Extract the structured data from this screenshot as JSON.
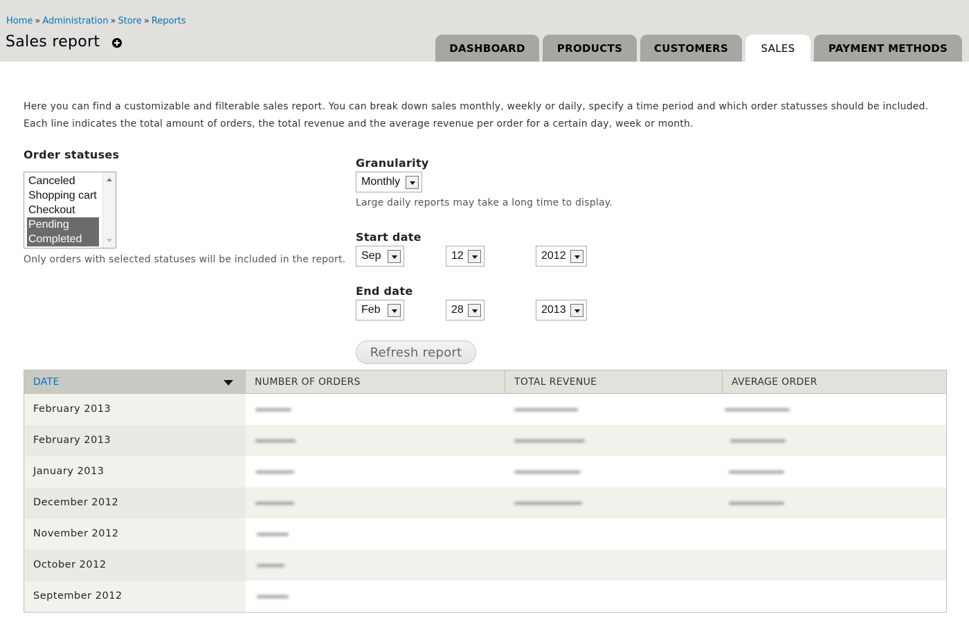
{
  "breadcrumb": {
    "items": [
      "Home",
      "Administration",
      "Store",
      "Reports"
    ],
    "separator": "»"
  },
  "page": {
    "title": "Sales report"
  },
  "tabs": [
    {
      "label": "DASHBOARD",
      "active": false
    },
    {
      "label": "PRODUCTS",
      "active": false
    },
    {
      "label": "CUSTOMERS",
      "active": false
    },
    {
      "label": "SALES",
      "active": true
    },
    {
      "label": "PAYMENT METHODS",
      "active": false
    }
  ],
  "intro": {
    "line1": "Here you can find a customizable and filterable sales report. You can break down sales monthly, weekly or daily, specify a time period and which order statusses should be included.",
    "line2": "Each line indicates the total amount of orders, the total revenue and the average revenue per order for a certain day, week or month."
  },
  "order_statuses": {
    "label": "Order statuses",
    "options": [
      {
        "label": "Canceled",
        "selected": false
      },
      {
        "label": "Shopping cart",
        "selected": false
      },
      {
        "label": "Checkout",
        "selected": false
      },
      {
        "label": "Pending",
        "selected": true
      },
      {
        "label": "Completed",
        "selected": true
      }
    ],
    "description": "Only orders with selected statuses will be included in the report."
  },
  "granularity": {
    "label": "Granularity",
    "value": "Monthly",
    "description": "Large daily reports may take a long time to display."
  },
  "start_date": {
    "label": "Start date",
    "month": "Sep",
    "day": "12",
    "year": "2012"
  },
  "end_date": {
    "label": "End date",
    "month": "Feb",
    "day": "28",
    "year": "2013"
  },
  "refresh_button": "Refresh report",
  "table": {
    "headers": {
      "date": "DATE",
      "orders": "NUMBER OF ORDERS",
      "revenue": "TOTAL REVENUE",
      "average": "AVERAGE ORDER"
    },
    "rows": [
      {
        "date": "February 2013",
        "has_values": true
      },
      {
        "date": "February 2013",
        "has_values": true
      },
      {
        "date": "January 2013",
        "has_values": true
      },
      {
        "date": "December 2012",
        "has_values": true
      },
      {
        "date": "November 2012",
        "has_values": false
      },
      {
        "date": "October 2012",
        "has_values": false
      },
      {
        "date": "September 2012",
        "has_values": false
      }
    ]
  },
  "colors": {
    "link": "#0074bd",
    "header_bg": "#e1e0dc",
    "tab_bg": "#a6a7a2",
    "selected_option_bg": "#6b6b6b"
  }
}
